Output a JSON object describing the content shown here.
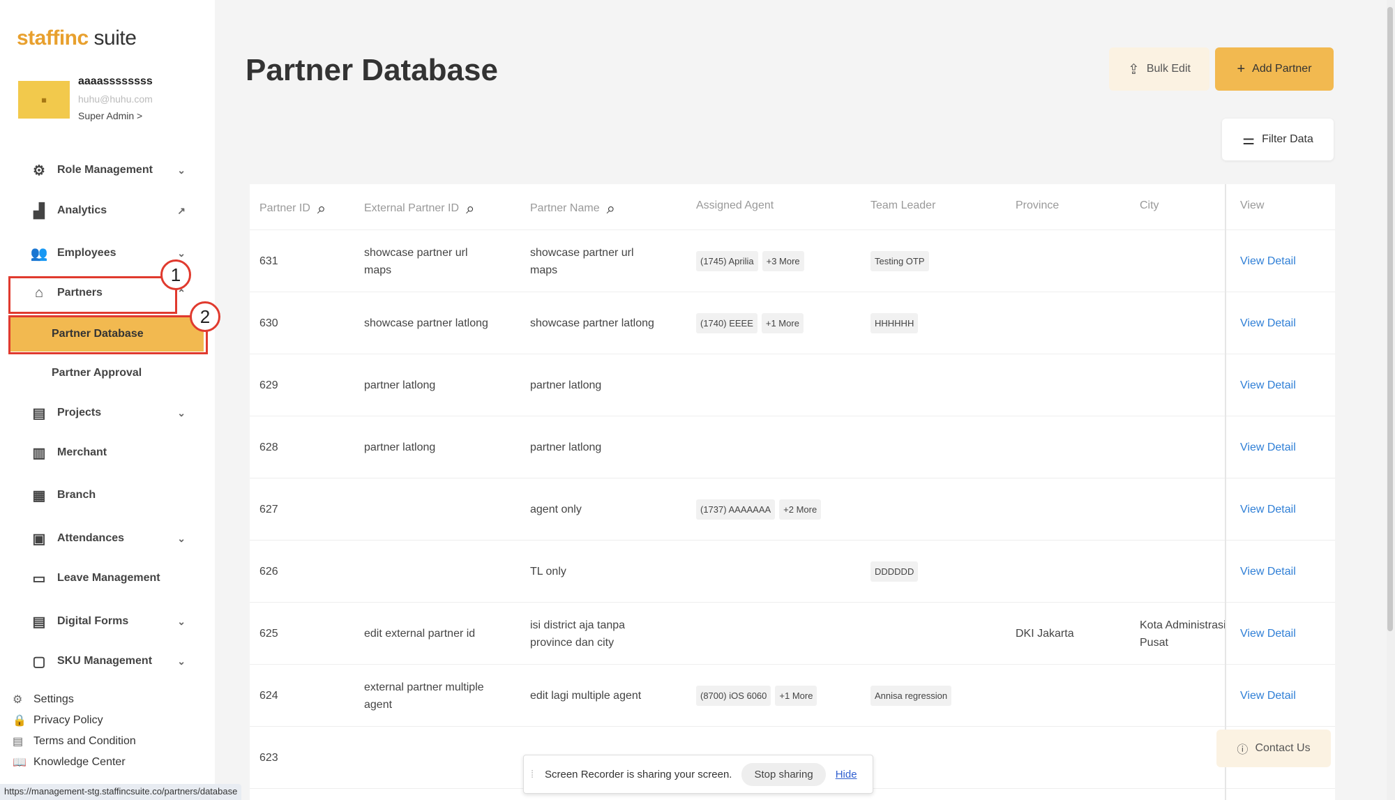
{
  "brand": {
    "logo_part1": "staffinc",
    "logo_part2": "suite"
  },
  "profile": {
    "name": "aaaassssssss",
    "email": "huhu@huhu.com",
    "role": "Super Admin >"
  },
  "sidebar": {
    "items": [
      {
        "label": "Role Management",
        "icon": "role-icon"
      },
      {
        "label": "Analytics",
        "icon": "analytics-icon"
      },
      {
        "label": "Employees",
        "icon": "employees-icon"
      },
      {
        "label": "Partners",
        "icon": "store-icon"
      },
      {
        "label": "Projects",
        "icon": "projects-icon"
      },
      {
        "label": "Merchant",
        "icon": "merchant-icon"
      },
      {
        "label": "Branch",
        "icon": "branch-icon"
      },
      {
        "label": "Attendances",
        "icon": "attendance-icon"
      },
      {
        "label": "Leave Management",
        "icon": "calendar-icon"
      },
      {
        "label": "Digital Forms",
        "icon": "forms-icon"
      },
      {
        "label": "SKU Management",
        "icon": "sku-icon"
      }
    ],
    "sub_items": [
      {
        "label": "Partner Database"
      },
      {
        "label": "Partner Approval"
      }
    ],
    "footer": [
      {
        "label": "Settings",
        "icon": "gear-icon"
      },
      {
        "label": "Privacy Policy",
        "icon": "lock-icon"
      },
      {
        "label": "Terms and Condition",
        "icon": "document-icon"
      },
      {
        "label": "Knowledge Center",
        "icon": "book-icon"
      }
    ],
    "annotations": [
      "1",
      "2"
    ]
  },
  "status_url": "https://management-stg.staffincsuite.co/partners/database",
  "header": {
    "title": "Partner Database",
    "bulk_edit": "Bulk Edit",
    "add_partner": "Add Partner",
    "filter": "Filter Data"
  },
  "table": {
    "columns": [
      "Partner ID",
      "External Partner ID",
      "Partner Name",
      "Assigned Agent",
      "Team Leader",
      "Province",
      "City",
      "View"
    ],
    "rows": [
      {
        "id": "631",
        "ext": "showcase partner url maps",
        "name": "showcase partner url maps",
        "agent": "(1745) Aprilia",
        "agent_more": "+3 More",
        "tl": "Testing OTP",
        "province": "",
        "city": "",
        "view": "View Detail"
      },
      {
        "id": "630",
        "ext": "showcase partner latlong",
        "name": "showcase partner latlong",
        "agent": "(1740) EEEE",
        "agent_more": "+1 More",
        "tl": "HHHHHH",
        "province": "",
        "city": "",
        "view": "View Detail"
      },
      {
        "id": "629",
        "ext": "partner latlong",
        "name": "partner latlong",
        "agent": "",
        "agent_more": "",
        "tl": "",
        "province": "",
        "city": "",
        "view": "View Detail"
      },
      {
        "id": "628",
        "ext": "partner latlong",
        "name": "partner latlong",
        "agent": "",
        "agent_more": "",
        "tl": "",
        "province": "",
        "city": "",
        "view": "View Detail"
      },
      {
        "id": "627",
        "ext": "",
        "name": "agent only",
        "agent": "(1737) AAAAAAA",
        "agent_more": "+2 More",
        "tl": "",
        "province": "",
        "city": "",
        "view": "View Detail"
      },
      {
        "id": "626",
        "ext": "",
        "name": "TL only",
        "agent": "",
        "agent_more": "",
        "tl": "DDDDDD",
        "province": "",
        "city": "",
        "view": "View Detail"
      },
      {
        "id": "625",
        "ext": "edit external partner id",
        "name": "isi district aja tanpa province dan city",
        "agent": "",
        "agent_more": "",
        "tl": "",
        "province": "DKI Jakarta",
        "city": "Kota Administrasi Pusat",
        "view": "View Detail"
      },
      {
        "id": "624",
        "ext": "external partner multiple agent",
        "name": "edit lagi multiple agent",
        "agent": "(8700) iOS 6060",
        "agent_more": "+1 More",
        "tl": "Annisa regression",
        "province": "",
        "city": "",
        "view": "View Detail"
      },
      {
        "id": "623",
        "ext": "",
        "name": "",
        "agent": "",
        "agent_more": "",
        "tl": "",
        "province": "",
        "city": "",
        "view": ""
      }
    ]
  },
  "contact": "Contact Us",
  "recorder": {
    "text": "Screen Recorder is sharing your screen.",
    "stop": "Stop sharing",
    "hide": "Hide"
  },
  "colors": {
    "accent": "#f2b950",
    "annotation": "#e03a2e",
    "link": "#2f7fd6"
  }
}
